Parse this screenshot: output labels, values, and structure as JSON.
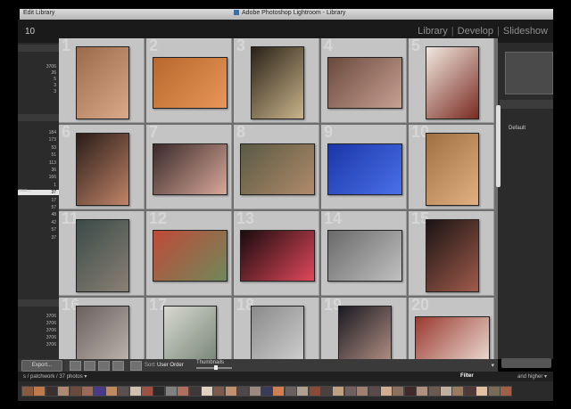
{
  "app": {
    "window_title": "Adobe Photoshop Lightroom - Library",
    "menu_fragment": "Edit   Library",
    "image_count_fragment": "10"
  },
  "modules": [
    {
      "label": "Library",
      "active": true
    },
    {
      "label": "Develop",
      "active": false
    },
    {
      "label": "Slideshow",
      "active": false
    }
  ],
  "left_panel": {
    "counts_top": [
      "3706",
      "26",
      "5",
      "3",
      "3"
    ],
    "counts_mid": [
      "184",
      "173",
      "53",
      "51",
      "113",
      "36",
      "166",
      "1",
      "37",
      "17",
      "57",
      "48",
      "42",
      "57",
      "37"
    ],
    "counts_bottom": [
      "3706",
      "3706",
      "3706",
      "3706",
      "3706"
    ],
    "label_fragment": "mas...",
    "selected_count": "37",
    "export_label": "Export..."
  },
  "grid": {
    "cells": [
      {
        "index": "1",
        "colors": [
          "#9a6a4a",
          "#d9a98a"
        ]
      },
      {
        "index": "2",
        "colors": [
          "#b8682c",
          "#e8965a"
        ]
      },
      {
        "index": "3",
        "colors": [
          "#2a2218",
          "#c9b48a"
        ]
      },
      {
        "index": "4",
        "colors": [
          "#6a4a3c",
          "#c8a094"
        ]
      },
      {
        "index": "5",
        "colors": [
          "#f0e8e0",
          "#7a2a20"
        ]
      },
      {
        "index": "6",
        "colors": [
          "#2a1c18",
          "#c08468"
        ]
      },
      {
        "index": "7",
        "colors": [
          "#3a2a2a",
          "#d8a898"
        ]
      },
      {
        "index": "8",
        "colors": [
          "#5a5a44",
          "#b08a6a"
        ]
      },
      {
        "index": "9",
        "colors": [
          "#1a36a8",
          "#4a70e8"
        ]
      },
      {
        "index": "10",
        "colors": [
          "#a07040",
          "#e0b080"
        ]
      },
      {
        "index": "11",
        "colors": [
          "#3a4a48",
          "#8a8074"
        ]
      },
      {
        "index": "12",
        "colors": [
          "#c04a38",
          "#70885a"
        ]
      },
      {
        "index": "13",
        "colors": [
          "#1a0c0e",
          "#e0485a"
        ]
      },
      {
        "index": "14",
        "colors": [
          "#6a6a6a",
          "#c0c0c0"
        ]
      },
      {
        "index": "15",
        "colors": [
          "#1a1414",
          "#a05a4a"
        ]
      },
      {
        "index": "16",
        "colors": [
          "#6a6060",
          "#c8c0b8"
        ]
      },
      {
        "index": "17",
        "colors": [
          "#d8d8d0",
          "#6a7a6a"
        ]
      },
      {
        "index": "18",
        "colors": [
          "#8a8a8a",
          "#d8d8d8"
        ]
      },
      {
        "index": "19",
        "colors": [
          "#1a1a22",
          "#c8a090"
        ]
      },
      {
        "index": "20",
        "colors": [
          "#9a3a30",
          "#eee0d8"
        ]
      }
    ]
  },
  "toolbar": {
    "sort_label": "Sort:",
    "sort_value": "User Order",
    "thumbnails_label": "Thumbnails",
    "menu_glyph": "▾"
  },
  "right_panel": {
    "preset_label": "Default",
    "section_glyph": "Q"
  },
  "filmstrip": {
    "path": "s / patchwork / 37 photos ▾",
    "filter_label": "Filter",
    "rating_label": "and higher ▾",
    "thumb_colors": [
      "#8a5a40",
      "#c07a4a",
      "#3a3030",
      "#b08a70",
      "#6a4a3a",
      "#9a6a5a",
      "#4a3a8a",
      "#c08a60",
      "#5a5050",
      "#d0c0b0",
      "#a05040",
      "#2a2a2a",
      "#808080",
      "#b07060",
      "#403838",
      "#e0d0c0",
      "#7a5a4a",
      "#c09070",
      "#504848",
      "#9a8a80",
      "#3a3a5a",
      "#d08050",
      "#6a6060",
      "#b0a090",
      "#8a4a3a",
      "#4a4040",
      "#c0a080",
      "#706060",
      "#a08070",
      "#5a4a4a",
      "#d0b090",
      "#8a7060",
      "#402a28",
      "#b09080",
      "#6a5a50",
      "#c0b0a0",
      "#9a7a60",
      "#503838",
      "#e0c0a0",
      "#7a6a5a",
      "#a06048"
    ]
  }
}
